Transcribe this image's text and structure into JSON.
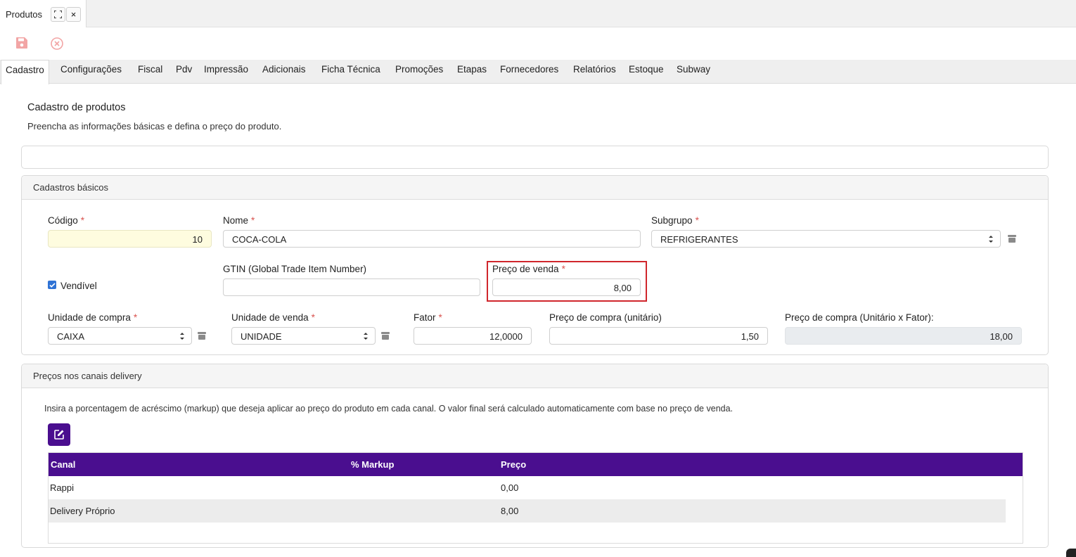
{
  "window_tab": {
    "title": "Produtos",
    "maximize_icon": "maximize-icon",
    "close_label": "×"
  },
  "toolbar": {
    "save_icon": "save-icon",
    "cancel_icon": "cancel-circle-icon"
  },
  "tabs": [
    {
      "label": "Cadastro",
      "active": true
    },
    {
      "label": "Configurações"
    },
    {
      "label": "Fiscal"
    },
    {
      "label": "Pdv"
    },
    {
      "label": "Impressão"
    },
    {
      "label": "Adicionais"
    },
    {
      "label": "Ficha Técnica"
    },
    {
      "label": "Promoções"
    },
    {
      "label": "Etapas"
    },
    {
      "label": "Fornecedores"
    },
    {
      "label": "Relatórios"
    },
    {
      "label": "Estoque"
    },
    {
      "label": "Subway"
    }
  ],
  "page": {
    "title": "Cadastro de produtos",
    "subtitle": "Preencha as informações básicas e defina o preço do produto."
  },
  "basic": {
    "header": "Cadastros básicos",
    "codigo": {
      "label": "Código",
      "value": "10"
    },
    "nome": {
      "label": "Nome",
      "value": "COCA-COLA"
    },
    "subgrupo": {
      "label": "Subgrupo",
      "value": "REFRIGERANTES"
    },
    "vendivel": {
      "label": "Vendível",
      "checked": true
    },
    "gtin": {
      "label": "GTIN (Global Trade Item Number)",
      "value": ""
    },
    "preco_venda": {
      "label": "Preço de venda",
      "value": "8,00"
    },
    "unidade_compra": {
      "label": "Unidade de compra",
      "value": "CAIXA"
    },
    "unidade_venda": {
      "label": "Unidade de venda",
      "value": "UNIDADE"
    },
    "fator": {
      "label": "Fator",
      "value": "12,0000"
    },
    "preco_compra": {
      "label": "Preço de compra (unitário)",
      "value": "1,50"
    },
    "preco_compra_total": {
      "label": "Preço de compra (Unitário x Fator):",
      "value": "18,00"
    },
    "required_mark": "*"
  },
  "delivery": {
    "header": "Preços nos canais delivery",
    "description": "Insira a porcentagem de acréscimo (markup) que deseja aplicar ao preço do produto em cada canal. O valor final será calculado automaticamente com base no preço de venda.",
    "columns": [
      "Canal",
      "% Markup",
      "Preço"
    ],
    "rows": [
      {
        "canal": "Rappi",
        "markup": "",
        "preco": "0,00"
      },
      {
        "canal": "Delivery Próprio",
        "markup": "",
        "preco": "8,00"
      }
    ]
  },
  "colors": {
    "accent": "#4a0e8f",
    "highlight": "#d0262c",
    "required": "#d9534f",
    "checkbox": "#2f73d5"
  }
}
